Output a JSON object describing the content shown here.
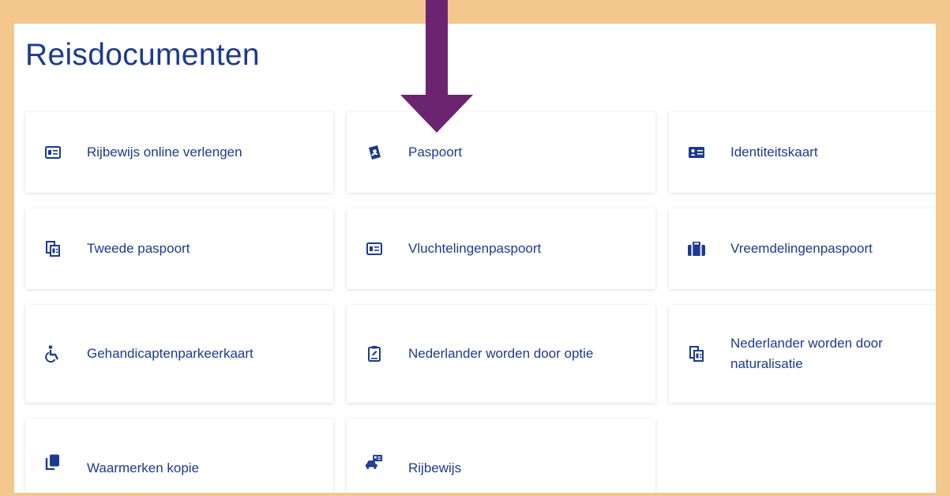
{
  "page": {
    "title": "Reisdocumenten",
    "accent": "#1c3a8f",
    "frame_color": "#f3c78e",
    "arrow_color": "#6b2470"
  },
  "tiles": [
    {
      "label": "Rijbewijs online verlengen",
      "icon": "id-card-outline-icon"
    },
    {
      "label": "Paspoort",
      "icon": "passport-icon"
    },
    {
      "label": "Identiteitskaart",
      "icon": "id-card-icon"
    },
    {
      "label": "Tweede paspoort",
      "icon": "documents-stack-icon"
    },
    {
      "label": "Vluchtelingenpaspoort",
      "icon": "id-card-outline-icon"
    },
    {
      "label": "Vreemdelingenpaspoort",
      "icon": "suitcase-icon"
    },
    {
      "label": "Gehandicaptenparkeerkaart",
      "icon": "wheelchair-icon"
    },
    {
      "label": "Nederlander worden door optie",
      "icon": "clipboard-document-icon"
    },
    {
      "label": "Nederlander worden door naturalisatie",
      "icon": "documents-stack-icon"
    },
    {
      "label": "Waarmerken kopie",
      "icon": "copy-icon"
    },
    {
      "label": "Rijbewijs",
      "icon": "driver-license-icon"
    }
  ]
}
